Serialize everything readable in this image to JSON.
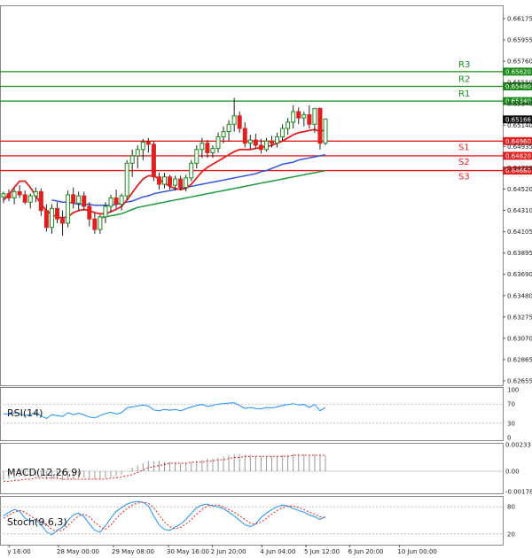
{
  "chart_data": {
    "type": "candlestick",
    "instrument": "",
    "main": {
      "price_ticks": [
        "0.66175",
        "0.65955",
        "0.65760",
        "0.65550",
        "0.65340",
        "0.65140",
        "0.64935",
        "0.64725",
        "0.64520",
        "0.64310",
        "0.64105",
        "0.63895",
        "0.63690",
        "0.63480",
        "0.63275",
        "0.63070",
        "0.62865",
        "0.62655"
      ],
      "ylim": [
        0.6264,
        0.6625
      ],
      "levels": [
        {
          "label": "R3",
          "value": 0.6562,
          "value_text": "0.65620",
          "color": "#1a8a1a"
        },
        {
          "label": "R2",
          "value": 0.6548,
          "value_text": "0.65480",
          "color": "#1a8a1a"
        },
        {
          "label": "R1",
          "value": 0.6534,
          "value_text": "0.65340",
          "color": "#1a8a1a"
        },
        {
          "label": "S1",
          "value": 0.6496,
          "value_text": "0.64960",
          "color": "#e02020"
        },
        {
          "label": "S2",
          "value": 0.6482,
          "value_text": "0.64820",
          "color": "#e02020"
        },
        {
          "label": "S3",
          "value": 0.6468,
          "value_text": "0.64680",
          "color": "#e02020"
        }
      ],
      "current_price": {
        "value": 0.65166,
        "value_text": "0.65166"
      },
      "candles": [
        [
          0.6443,
          0.6448,
          0.6437,
          0.6446
        ],
        [
          0.6446,
          0.645,
          0.6439,
          0.6442
        ],
        [
          0.6442,
          0.6451,
          0.6436,
          0.6448
        ],
        [
          0.6448,
          0.6454,
          0.6442,
          0.6445
        ],
        [
          0.6445,
          0.6449,
          0.6436,
          0.6438
        ],
        [
          0.6438,
          0.6446,
          0.6432,
          0.6444
        ],
        [
          0.6444,
          0.6452,
          0.6438,
          0.6448
        ],
        [
          0.6448,
          0.6451,
          0.6425,
          0.643
        ],
        [
          0.643,
          0.6436,
          0.641,
          0.6414
        ],
        [
          0.6414,
          0.6436,
          0.6408,
          0.6432
        ],
        [
          0.6432,
          0.6438,
          0.6418,
          0.6422
        ],
        [
          0.6422,
          0.643,
          0.6406,
          0.6418
        ],
        [
          0.6418,
          0.6449,
          0.6414,
          0.6445
        ],
        [
          0.6445,
          0.6452,
          0.6432,
          0.6437
        ],
        [
          0.6437,
          0.6448,
          0.643,
          0.6444
        ],
        [
          0.6444,
          0.6448,
          0.643,
          0.6434
        ],
        [
          0.6434,
          0.6438,
          0.6415,
          0.6422
        ],
        [
          0.6422,
          0.6428,
          0.6408,
          0.6412
        ],
        [
          0.6412,
          0.6426,
          0.6408,
          0.6424
        ],
        [
          0.6424,
          0.6438,
          0.6418,
          0.6434
        ],
        [
          0.6434,
          0.6445,
          0.6428,
          0.6442
        ],
        [
          0.6442,
          0.645,
          0.6432,
          0.6436
        ],
        [
          0.6436,
          0.6446,
          0.643,
          0.6444
        ],
        [
          0.6444,
          0.6478,
          0.644,
          0.6475
        ],
        [
          0.6475,
          0.6488,
          0.6462,
          0.6482
        ],
        [
          0.6482,
          0.6492,
          0.647,
          0.6488
        ],
        [
          0.6488,
          0.6498,
          0.6478,
          0.6495
        ],
        [
          0.6495,
          0.6499,
          0.6485,
          0.6493
        ],
        [
          0.6493,
          0.6496,
          0.6458,
          0.6462
        ],
        [
          0.6462,
          0.6466,
          0.645,
          0.6455
        ],
        [
          0.6455,
          0.6466,
          0.6451,
          0.6462
        ],
        [
          0.6462,
          0.6464,
          0.645,
          0.6454
        ],
        [
          0.6454,
          0.6463,
          0.6449,
          0.646
        ],
        [
          0.646,
          0.6463,
          0.6449,
          0.6452
        ],
        [
          0.6452,
          0.6464,
          0.6448,
          0.6461
        ],
        [
          0.6461,
          0.6478,
          0.6458,
          0.6475
        ],
        [
          0.6475,
          0.6492,
          0.647,
          0.6488
        ],
        [
          0.6488,
          0.6499,
          0.648,
          0.6494
        ],
        [
          0.6494,
          0.6497,
          0.648,
          0.6485
        ],
        [
          0.6485,
          0.6492,
          0.648,
          0.6489
        ],
        [
          0.6489,
          0.6504,
          0.6485,
          0.65
        ],
        [
          0.65,
          0.651,
          0.6494,
          0.6505
        ],
        [
          0.6505,
          0.6516,
          0.6496,
          0.6512
        ],
        [
          0.6512,
          0.6537,
          0.6505,
          0.652
        ],
        [
          0.652,
          0.6524,
          0.6504,
          0.6508
        ],
        [
          0.6508,
          0.6514,
          0.649,
          0.6494
        ],
        [
          0.6494,
          0.6502,
          0.6488,
          0.6497
        ],
        [
          0.6497,
          0.6503,
          0.6489,
          0.6492
        ],
        [
          0.6492,
          0.6498,
          0.6484,
          0.6488
        ],
        [
          0.6488,
          0.6499,
          0.6486,
          0.6496
        ],
        [
          0.6496,
          0.6501,
          0.649,
          0.6494
        ],
        [
          0.6494,
          0.6504,
          0.649,
          0.65
        ],
        [
          0.65,
          0.6512,
          0.6496,
          0.6508
        ],
        [
          0.6508,
          0.6518,
          0.6502,
          0.6514
        ],
        [
          0.6514,
          0.653,
          0.6508,
          0.6524
        ],
        [
          0.6524,
          0.6528,
          0.6512,
          0.6518
        ],
        [
          0.6518,
          0.6524,
          0.651,
          0.6521
        ],
        [
          0.6521,
          0.653,
          0.6508,
          0.6512
        ],
        [
          0.6512,
          0.6526,
          0.6504,
          0.6527
        ],
        [
          0.6527,
          0.6528,
          0.6488,
          0.6494
        ],
        [
          0.6494,
          0.6502,
          0.6492,
          0.6517
        ]
      ],
      "ma_fast": [
        0.644,
        0.6445,
        0.6452,
        0.6458,
        0.6458,
        0.6452,
        0.6444,
        0.6436,
        0.643,
        0.6426,
        0.6424,
        0.6423,
        0.6424,
        0.6428,
        0.643,
        0.6431,
        0.643,
        0.6428,
        0.6427,
        0.6427,
        0.6429,
        0.6431,
        0.6434,
        0.644,
        0.6447,
        0.6454,
        0.646,
        0.6463,
        0.6463,
        0.646,
        0.6456,
        0.6453,
        0.6451,
        0.645,
        0.6451,
        0.6455,
        0.6461,
        0.6467,
        0.6471,
        0.6474,
        0.6477,
        0.648,
        0.6483,
        0.6486,
        0.6488,
        0.6488,
        0.6488,
        0.6489,
        0.649,
        0.6491,
        0.6492,
        0.6494,
        0.6496,
        0.6499,
        0.6502,
        0.6504,
        0.6505,
        0.6506,
        0.6507,
        0.6505,
        0.6507
      ],
      "ma_mid": [
        null,
        null,
        null,
        null,
        null,
        null,
        null,
        null,
        null,
        0.644,
        0.6439,
        0.6438,
        0.6438,
        0.6437,
        0.6436,
        0.6436,
        0.6436,
        0.6435,
        0.6435,
        0.6435,
        0.6435,
        0.6436,
        0.6437,
        0.6438,
        0.6439,
        0.6441,
        0.6443,
        0.6444,
        0.6446,
        0.6447,
        0.6448,
        0.6449,
        0.645,
        0.6451,
        0.6452,
        0.6453,
        0.6454,
        0.6455,
        0.6456,
        0.6457,
        0.6458,
        0.6459,
        0.646,
        0.6461,
        0.6462,
        0.6463,
        0.6464,
        0.6465,
        0.6467,
        0.6468,
        0.647,
        0.6472,
        0.6474,
        0.6475,
        0.6476,
        0.6478,
        0.6479,
        0.648,
        0.6481,
        0.6482,
        0.6483
      ],
      "ma_slow": [
        null,
        null,
        null,
        null,
        null,
        null,
        null,
        null,
        null,
        null,
        null,
        null,
        null,
        null,
        null,
        null,
        null,
        null,
        0.6423,
        0.6424,
        0.6425,
        0.6426,
        0.6427,
        0.6429,
        0.6431,
        0.6433,
        0.6434,
        0.6435,
        0.6436,
        0.6437,
        0.6438,
        0.6439,
        0.644,
        0.6441,
        0.6442,
        0.6443,
        0.6444,
        0.6445,
        0.6446,
        0.6447,
        0.6448,
        0.6449,
        0.645,
        0.6451,
        0.6452,
        0.6453,
        0.6454,
        0.6455,
        0.6456,
        0.6457,
        0.6458,
        0.6459,
        0.646,
        0.6461,
        0.6462,
        0.6463,
        0.6464,
        0.6465,
        0.6466,
        0.6467,
        0.6468
      ]
    },
    "rsi": {
      "title": "RSI(14)",
      "ticks": [
        "100",
        "70",
        "30",
        "0"
      ],
      "ylim": [
        0,
        100
      ],
      "levels": [
        70,
        30
      ],
      "values": [
        50,
        48,
        52,
        50,
        46,
        49,
        52,
        45,
        40,
        48,
        46,
        44,
        52,
        48,
        51,
        47,
        43,
        41,
        46,
        50,
        53,
        49,
        52,
        62,
        64,
        66,
        68,
        66,
        58,
        56,
        59,
        57,
        59,
        56,
        60,
        64,
        67,
        69,
        65,
        67,
        70,
        71,
        72,
        73,
        67,
        61,
        63,
        61,
        60,
        63,
        62,
        64,
        67,
        69,
        71,
        68,
        69,
        63,
        69,
        56,
        63
      ],
      "color": "#1e90ff"
    },
    "macd": {
      "title": "MACD(12,26,9)",
      "ticks": [
        "0.00233",
        "0.00",
        "-0.001788"
      ],
      "ylim": [
        -0.001788,
        0.00233
      ],
      "hist": [
        -0.0008,
        -0.0007,
        -0.0006,
        -0.0005,
        -0.0005,
        -0.0005,
        -0.0004,
        -0.0005,
        -0.0007,
        -0.0007,
        -0.0007,
        -0.0008,
        -0.0007,
        -0.0007,
        -0.0006,
        -0.0006,
        -0.0007,
        -0.0007,
        -0.0007,
        -0.0006,
        -0.0005,
        -0.0004,
        -0.0003,
        0.0,
        0.0003,
        0.0005,
        0.0007,
        0.0009,
        0.0009,
        0.0009,
        0.0008,
        0.0008,
        0.0008,
        0.0007,
        0.0007,
        0.0008,
        0.0009,
        0.001,
        0.0011,
        0.0011,
        0.0012,
        0.0013,
        0.0014,
        0.0015,
        0.0015,
        0.0014,
        0.0014,
        0.0013,
        0.0013,
        0.0013,
        0.0013,
        0.0013,
        0.0014,
        0.0014,
        0.0015,
        0.0015,
        0.0015,
        0.0014,
        0.0015,
        0.0014,
        0.0014
      ],
      "signal": [
        -0.0009,
        -0.0009,
        -0.0008,
        -0.0008,
        -0.0007,
        -0.0007,
        -0.0006,
        -0.0006,
        -0.0006,
        -0.0006,
        -0.0006,
        -0.0007,
        -0.0007,
        -0.0007,
        -0.0007,
        -0.0007,
        -0.0007,
        -0.0007,
        -0.0007,
        -0.0007,
        -0.0006,
        -0.0006,
        -0.0005,
        -0.0004,
        -0.0003,
        -0.0001,
        0.0001,
        0.0003,
        0.0004,
        0.0005,
        0.0006,
        0.0007,
        0.0007,
        0.0007,
        0.0007,
        0.0008,
        0.0008,
        0.0008,
        0.0009,
        0.0009,
        0.001,
        0.001,
        0.0011,
        0.0012,
        0.0012,
        0.0013,
        0.0013,
        0.0013,
        0.0013,
        0.0013,
        0.0013,
        0.0013,
        0.0013,
        0.0013,
        0.0014,
        0.0014,
        0.0014,
        0.0014,
        0.0014,
        0.0014,
        0.0014
      ],
      "signal_color": "#e02020",
      "hist_color": "#9a9a9a"
    },
    "stoch": {
      "title": "Stoch(9,6,3)",
      "ticks": [
        "80",
        "20"
      ],
      "ylim": [
        0,
        100
      ],
      "levels": [
        80,
        20
      ],
      "k": [
        60,
        68,
        74,
        70,
        55,
        48,
        52,
        40,
        25,
        18,
        28,
        35,
        50,
        62,
        66,
        58,
        42,
        28,
        24,
        38,
        55,
        70,
        78,
        86,
        90,
        92,
        90,
        82,
        60,
        40,
        30,
        28,
        35,
        42,
        52,
        66,
        78,
        84,
        86,
        82,
        80,
        76,
        68,
        60,
        50,
        40,
        36,
        42,
        56,
        66,
        74,
        80,
        84,
        82,
        76,
        72,
        68,
        62,
        58,
        52,
        58
      ],
      "d": [
        55,
        62,
        68,
        72,
        68,
        60,
        52,
        48,
        40,
        30,
        26,
        28,
        38,
        50,
        60,
        64,
        58,
        46,
        36,
        30,
        40,
        54,
        66,
        76,
        84,
        88,
        90,
        88,
        78,
        62,
        46,
        36,
        32,
        34,
        42,
        52,
        64,
        74,
        82,
        84,
        84,
        80,
        74,
        68,
        60,
        52,
        44,
        42,
        46,
        54,
        64,
        72,
        78,
        82,
        82,
        78,
        74,
        68,
        64,
        58,
        56
      ],
      "k_color": "#1e90ff",
      "d_color": "#e02020"
    },
    "time_labels": [
      {
        "i": 1,
        "text": "y 16:00"
      },
      {
        "i": 10,
        "text": "28 May 00:00"
      },
      {
        "i": 20,
        "text": "29 May 08:00"
      },
      {
        "i": 30,
        "text": "30 May 16:00"
      },
      {
        "i": 38,
        "text": "2 Jun 20:00"
      },
      {
        "i": 47,
        "text": "4 Jun 04:00"
      },
      {
        "i": 55,
        "text": "5 Jun 12:00"
      },
      {
        "i": 63,
        "text": "6 Jun 20:00"
      },
      {
        "i": 72,
        "text": "10 Jun 00:00"
      }
    ],
    "colors": {
      "bull": "#1a8a1a",
      "bear": "#e02020",
      "ma_fast": "#e02020",
      "ma_mid": "#3355dd",
      "ma_slow": "#1a9a3a",
      "grid": "#e8e8e8",
      "frame": "#888888"
    }
  }
}
